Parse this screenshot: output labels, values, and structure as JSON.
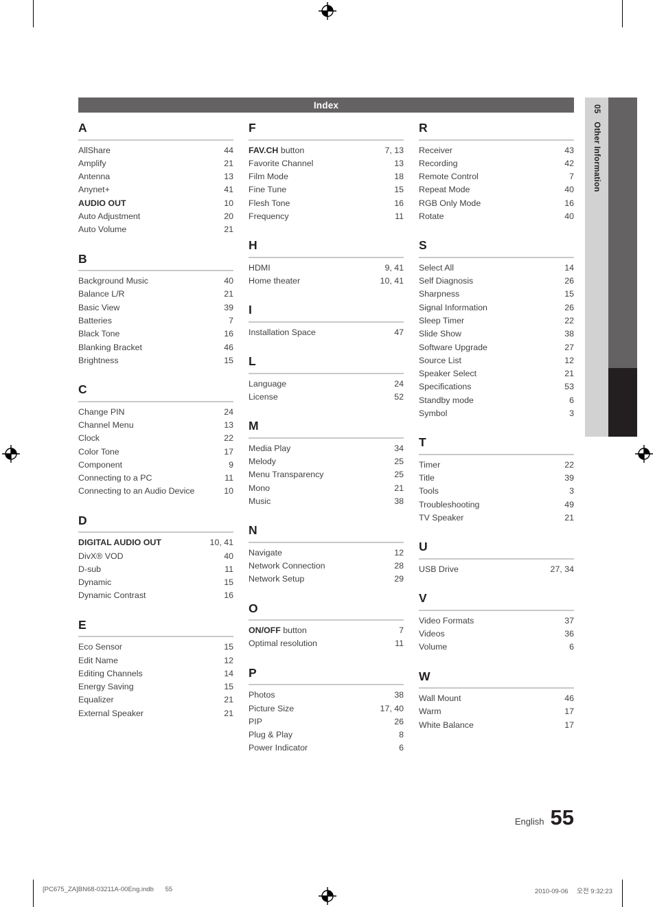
{
  "header": {
    "title": "Index"
  },
  "side_tab": {
    "number": "05",
    "label": "Other Information"
  },
  "footer": {
    "language": "English",
    "page_number": "55"
  },
  "print_meta": {
    "file": "[PC675_ZA]BN68-03211A-00Eng.indb",
    "page": "55",
    "date": "2010-09-06",
    "time": "오전 9:32:23"
  },
  "colors": {
    "header_bar": "#656263",
    "side_tab": "#d2d2d2",
    "side_bar_gray": "#656263",
    "side_bar_dark": "#231f20",
    "rule": "#c8c8c8",
    "text": "#404040"
  },
  "columns": [
    {
      "groups": [
        {
          "letter": "A",
          "entries": [
            {
              "term": "AllShare",
              "page": "44",
              "bold": false
            },
            {
              "term": "Amplify",
              "page": "21",
              "bold": false
            },
            {
              "term": "Antenna",
              "page": "13",
              "bold": false
            },
            {
              "term": "Anynet+",
              "page": "41",
              "bold": false
            },
            {
              "term": "AUDIO OUT",
              "page": "10",
              "bold": true
            },
            {
              "term": "Auto Adjustment",
              "page": "20",
              "bold": false
            },
            {
              "term": "Auto Volume",
              "page": "21",
              "bold": false
            }
          ]
        },
        {
          "letter": "B",
          "entries": [
            {
              "term": "Background Music",
              "page": "40",
              "bold": false
            },
            {
              "term": "Balance L/R",
              "page": "21",
              "bold": false
            },
            {
              "term": "Basic View",
              "page": "39",
              "bold": false
            },
            {
              "term": "Batteries",
              "page": "7",
              "bold": false
            },
            {
              "term": "Black Tone",
              "page": "16",
              "bold": false
            },
            {
              "term": "Blanking Bracket",
              "page": "46",
              "bold": false
            },
            {
              "term": "Brightness",
              "page": "15",
              "bold": false
            }
          ]
        },
        {
          "letter": "C",
          "entries": [
            {
              "term": "Change PIN",
              "page": "24",
              "bold": false
            },
            {
              "term": "Channel Menu",
              "page": "13",
              "bold": false
            },
            {
              "term": "Clock",
              "page": "22",
              "bold": false
            },
            {
              "term": "Color Tone",
              "page": "17",
              "bold": false
            },
            {
              "term": "Component",
              "page": "9",
              "bold": false
            },
            {
              "term": "Connecting to a PC",
              "page": "11",
              "bold": false
            },
            {
              "term": "Connecting to an Audio Device",
              "page": "10",
              "bold": false
            }
          ]
        },
        {
          "letter": "D",
          "entries": [
            {
              "term": "DIGITAL AUDIO OUT",
              "page": "10, 41",
              "bold": true
            },
            {
              "term": "DivX® VOD",
              "page": "40",
              "bold": false
            },
            {
              "term": "D-sub",
              "page": "11",
              "bold": false
            },
            {
              "term": "Dynamic",
              "page": "15",
              "bold": false
            },
            {
              "term": "Dynamic Contrast",
              "page": "16",
              "bold": false
            }
          ]
        },
        {
          "letter": "E",
          "entries": [
            {
              "term": "Eco Sensor",
              "page": "15",
              "bold": false
            },
            {
              "term": "Edit Name",
              "page": "12",
              "bold": false
            },
            {
              "term": "Editing Channels",
              "page": "14",
              "bold": false
            },
            {
              "term": "Energy Saving",
              "page": "15",
              "bold": false
            },
            {
              "term": "Equalizer",
              "page": "21",
              "bold": false
            },
            {
              "term": "External Speaker",
              "page": "21",
              "bold": false
            }
          ]
        }
      ]
    },
    {
      "groups": [
        {
          "letter": "F",
          "entries": [
            {
              "term": "FAV.CH",
              "suffix": " button",
              "page": "7, 13",
              "bold": true
            },
            {
              "term": "Favorite Channel",
              "page": "13",
              "bold": false
            },
            {
              "term": "Film Mode",
              "page": "18",
              "bold": false
            },
            {
              "term": "Fine Tune",
              "page": "15",
              "bold": false
            },
            {
              "term": "Flesh Tone",
              "page": "16",
              "bold": false
            },
            {
              "term": "Frequency",
              "page": "11",
              "bold": false
            }
          ]
        },
        {
          "letter": "H",
          "entries": [
            {
              "term": "HDMI",
              "page": "9, 41",
              "bold": false
            },
            {
              "term": "Home theater",
              "page": "10, 41",
              "bold": false
            }
          ]
        },
        {
          "letter": "I",
          "entries": [
            {
              "term": "Installation Space",
              "page": "47",
              "bold": false
            }
          ]
        },
        {
          "letter": "L",
          "entries": [
            {
              "term": "Language",
              "page": "24",
              "bold": false
            },
            {
              "term": "License",
              "page": "52",
              "bold": false
            }
          ]
        },
        {
          "letter": "M",
          "entries": [
            {
              "term": "Media Play",
              "page": "34",
              "bold": false
            },
            {
              "term": "Melody",
              "page": "25",
              "bold": false
            },
            {
              "term": "Menu Transparency",
              "page": "25",
              "bold": false
            },
            {
              "term": "Mono",
              "page": "21",
              "bold": false
            },
            {
              "term": "Music",
              "page": "38",
              "bold": false
            }
          ]
        },
        {
          "letter": "N",
          "entries": [
            {
              "term": "Navigate",
              "page": "12",
              "bold": false
            },
            {
              "term": "Network Connection",
              "page": "28",
              "bold": false
            },
            {
              "term": "Network Setup",
              "page": "29",
              "bold": false
            }
          ]
        },
        {
          "letter": "O",
          "entries": [
            {
              "term": "ON/OFF",
              "suffix": " button",
              "page": "7",
              "bold": true
            },
            {
              "term": "Optimal resolution",
              "page": "11",
              "bold": false
            }
          ]
        },
        {
          "letter": "P",
          "entries": [
            {
              "term": "Photos",
              "page": "38",
              "bold": false
            },
            {
              "term": "Picture Size",
              "page": "17, 40",
              "bold": false
            },
            {
              "term": "PIP",
              "page": "26",
              "bold": false
            },
            {
              "term": "Plug & Play",
              "page": "8",
              "bold": false
            },
            {
              "term": "Power Indicator",
              "page": "6",
              "bold": false
            }
          ]
        }
      ]
    },
    {
      "groups": [
        {
          "letter": "R",
          "entries": [
            {
              "term": "Receiver",
              "page": "43",
              "bold": false
            },
            {
              "term": "Recording",
              "page": "42",
              "bold": false
            },
            {
              "term": "Remote Control",
              "page": "7",
              "bold": false
            },
            {
              "term": "Repeat Mode",
              "page": "40",
              "bold": false
            },
            {
              "term": "RGB Only Mode",
              "page": "16",
              "bold": false
            },
            {
              "term": "Rotate",
              "page": "40",
              "bold": false
            }
          ]
        },
        {
          "letter": "S",
          "entries": [
            {
              "term": "Select All",
              "page": "14",
              "bold": false
            },
            {
              "term": "Self Diagnosis",
              "page": "26",
              "bold": false
            },
            {
              "term": "Sharpness",
              "page": "15",
              "bold": false
            },
            {
              "term": "Signal Information",
              "page": "26",
              "bold": false
            },
            {
              "term": "Sleep Timer",
              "page": "22",
              "bold": false
            },
            {
              "term": "Slide Show",
              "page": "38",
              "bold": false
            },
            {
              "term": "Software Upgrade",
              "page": "27",
              "bold": false
            },
            {
              "term": "Source List",
              "page": "12",
              "bold": false
            },
            {
              "term": "Speaker Select",
              "page": "21",
              "bold": false
            },
            {
              "term": "Specifications",
              "page": "53",
              "bold": false
            },
            {
              "term": "Standby mode",
              "page": "6",
              "bold": false
            },
            {
              "term": "Symbol",
              "page": "3",
              "bold": false
            }
          ]
        },
        {
          "letter": "T",
          "entries": [
            {
              "term": "Timer",
              "page": "22",
              "bold": false
            },
            {
              "term": "Title",
              "page": "39",
              "bold": false
            },
            {
              "term": "Tools",
              "page": "3",
              "bold": false
            },
            {
              "term": "Troubleshooting",
              "page": "49",
              "bold": false
            },
            {
              "term": "TV Speaker",
              "page": "21",
              "bold": false
            }
          ]
        },
        {
          "letter": "U",
          "entries": [
            {
              "term": "USB Drive",
              "page": "27, 34",
              "bold": false
            }
          ]
        },
        {
          "letter": "V",
          "entries": [
            {
              "term": "Video Formats",
              "page": "37",
              "bold": false
            },
            {
              "term": "Videos",
              "page": "36",
              "bold": false
            },
            {
              "term": "Volume",
              "page": "6",
              "bold": false
            }
          ]
        },
        {
          "letter": "W",
          "entries": [
            {
              "term": "Wall Mount",
              "page": "46",
              "bold": false
            },
            {
              "term": "Warm",
              "page": "17",
              "bold": false
            },
            {
              "term": "White Balance",
              "page": "17",
              "bold": false
            }
          ]
        }
      ]
    }
  ]
}
